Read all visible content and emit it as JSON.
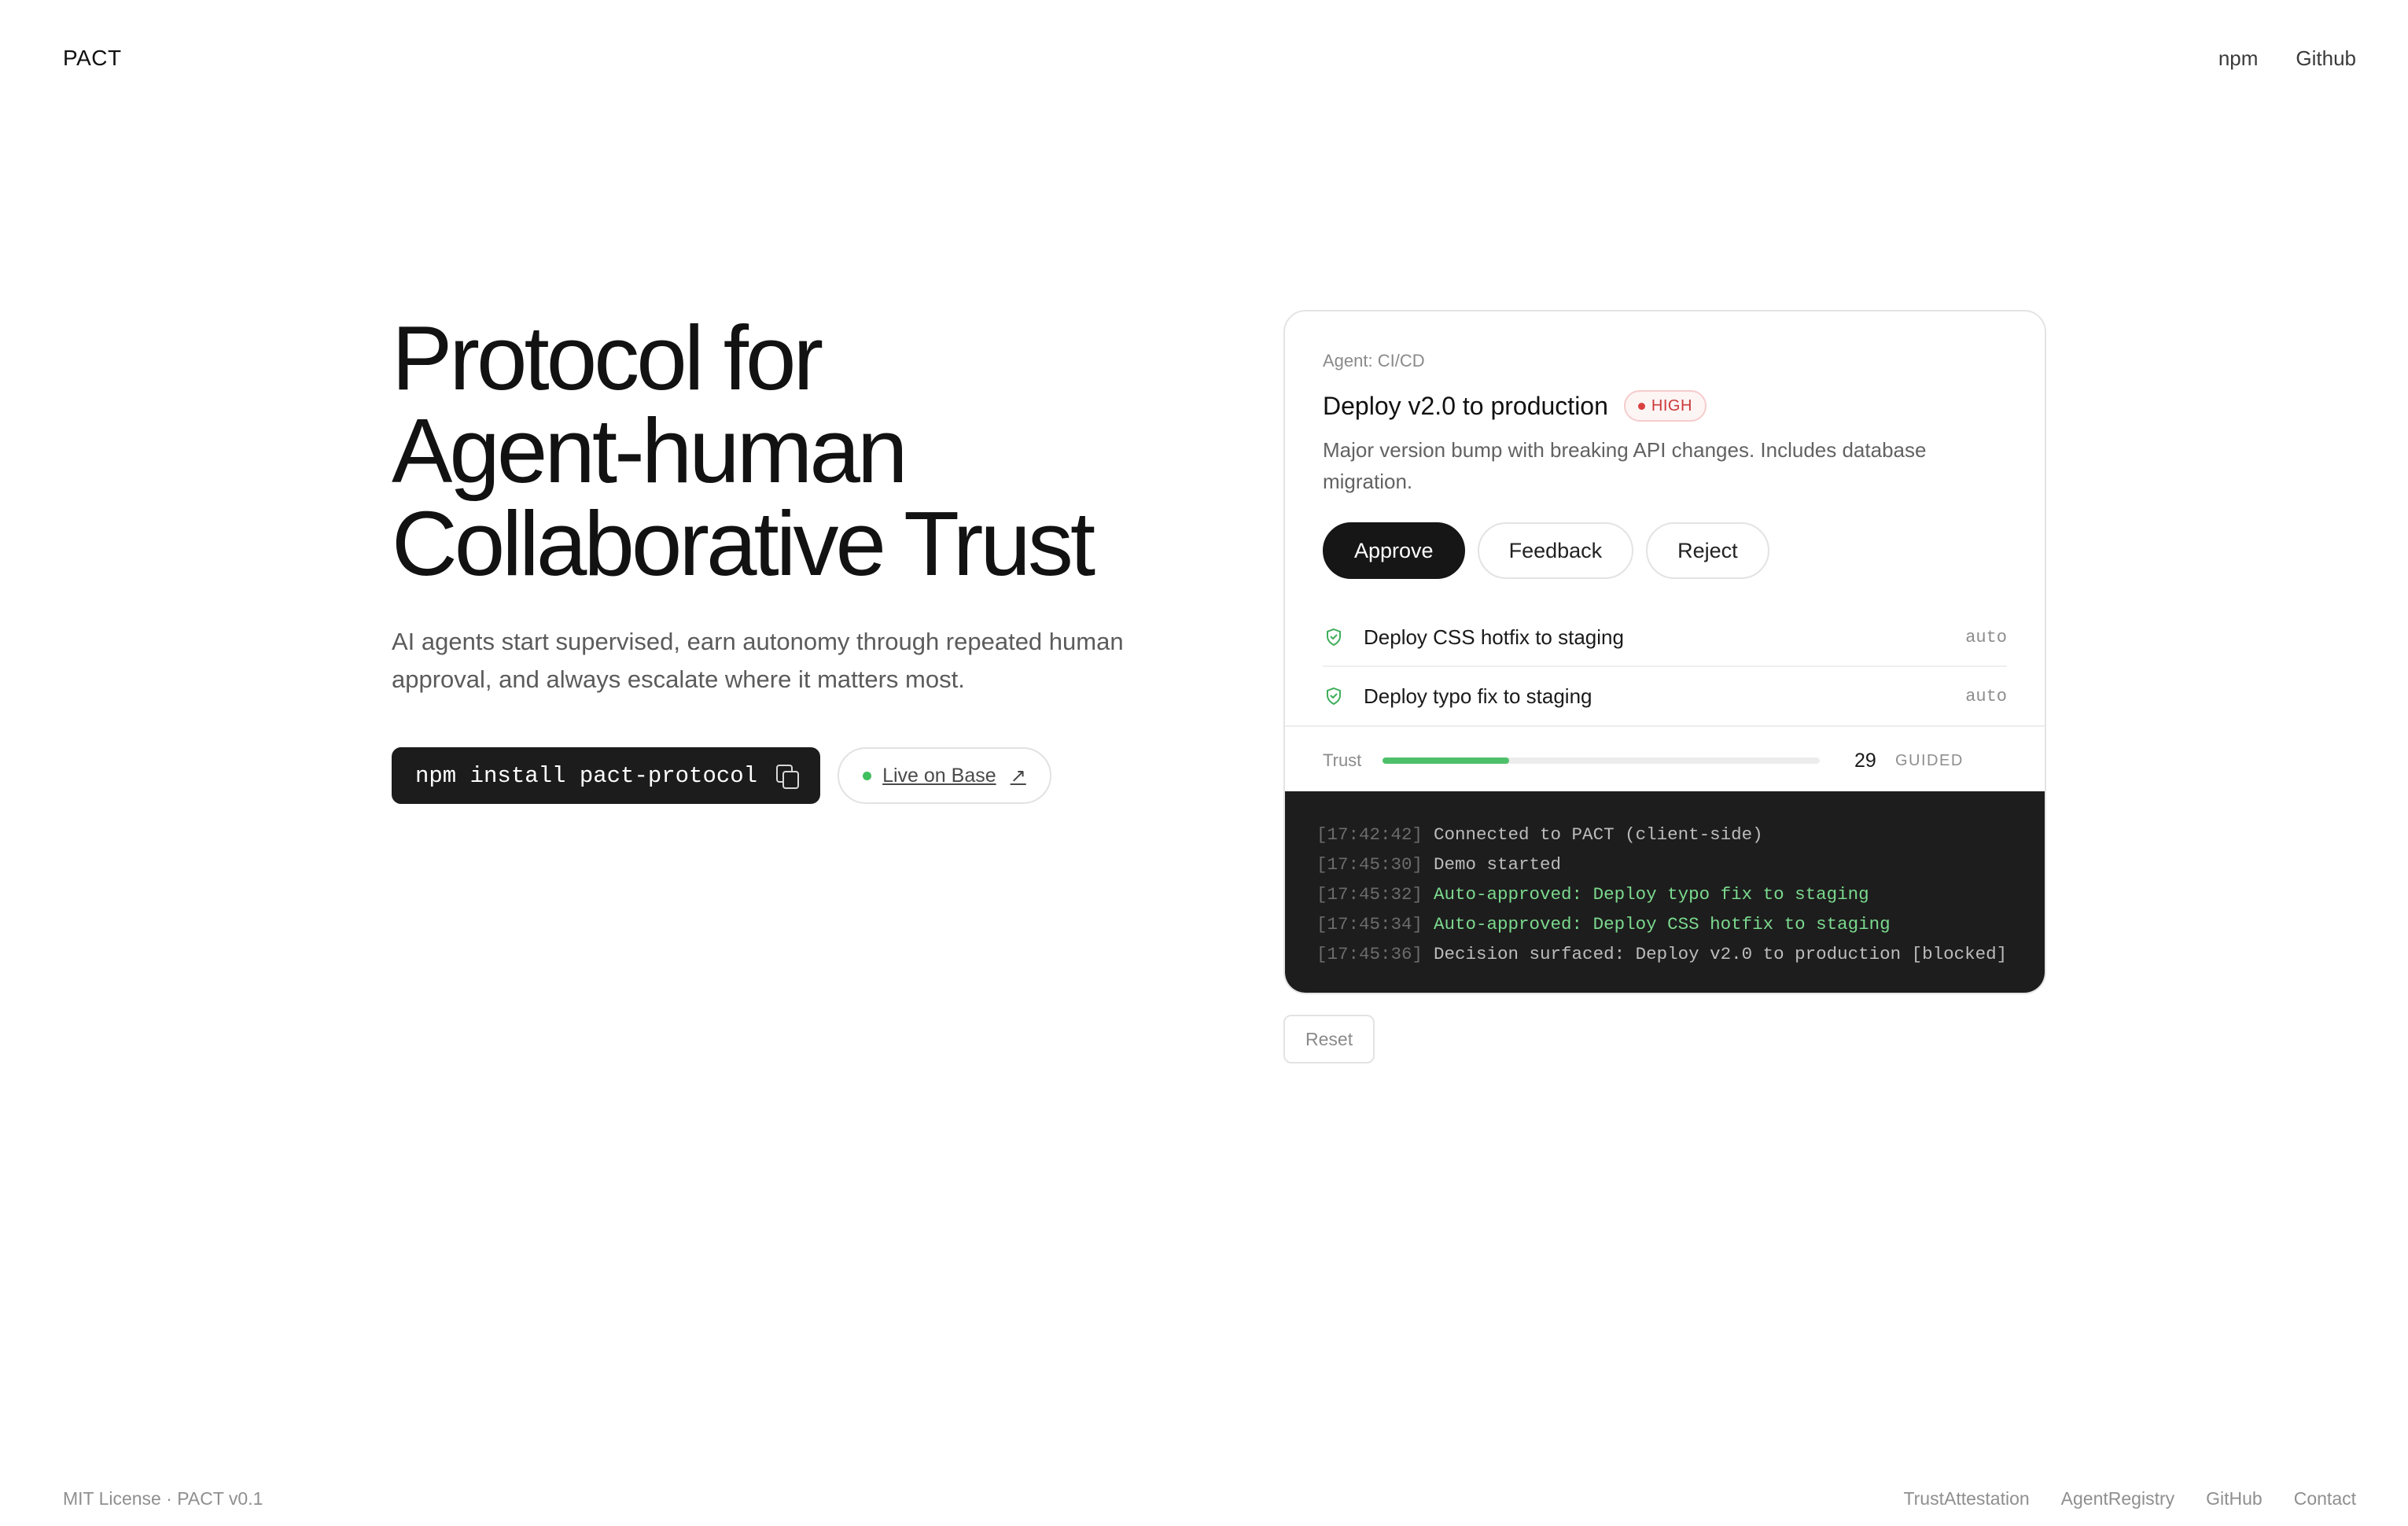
{
  "header": {
    "brand": "PACT",
    "nav": [
      {
        "label": "npm"
      },
      {
        "label": "Github"
      }
    ]
  },
  "hero": {
    "title_lines": [
      "Protocol for",
      "Agent-human",
      "Collaborative Trust"
    ],
    "subtitle": "AI agents start supervised, earn autonomy through repeated human approval, and always escalate where it matters most.",
    "install_command": "npm install pact-protocol",
    "copy_icon": "copy-icon",
    "live_label": "Live on Base",
    "live_dot_color": "#3fbf5d",
    "arrow_icon": "arrow-up-right-icon"
  },
  "demo": {
    "agent_label": "Agent: CI/CD",
    "decision": {
      "title": "Deploy v2.0 to production",
      "risk_badge": "HIGH",
      "risk_color": "#cc3a3a",
      "description": "Major version bump with breaking API changes. Includes database migration."
    },
    "actions": {
      "approve": "Approve",
      "feedback": "Feedback",
      "reject": "Reject"
    },
    "history": [
      {
        "label": "Deploy CSS hotfix to staging",
        "status": "auto",
        "icon": "shield-check-icon"
      },
      {
        "label": "Deploy typo fix to staging",
        "status": "auto",
        "icon": "shield-check-icon"
      }
    ],
    "trust": {
      "label": "Trust",
      "value": "29",
      "fraction": 0.29,
      "level": "GUIDED",
      "fill_color": "#4fc06a"
    },
    "log": [
      {
        "time": "[17:42:42]",
        "message": "Connected to PACT (client-side)",
        "kind": "info"
      },
      {
        "time": "[17:45:30]",
        "message": "Demo started",
        "kind": "info"
      },
      {
        "time": "[17:45:32]",
        "message": "Auto-approved: Deploy typo fix to staging",
        "kind": "ok"
      },
      {
        "time": "[17:45:34]",
        "message": "Auto-approved: Deploy CSS hotfix to staging",
        "kind": "ok"
      },
      {
        "time": "[17:45:36]",
        "message": "Decision surfaced: Deploy v2.0 to production [blocked]",
        "kind": "info"
      }
    ],
    "reset_label": "Reset"
  },
  "footer": {
    "left": "MIT License · PACT v0.1",
    "links": [
      {
        "label": "TrustAttestation"
      },
      {
        "label": "AgentRegistry"
      },
      {
        "label": "GitHub"
      },
      {
        "label": "Contact"
      }
    ]
  }
}
